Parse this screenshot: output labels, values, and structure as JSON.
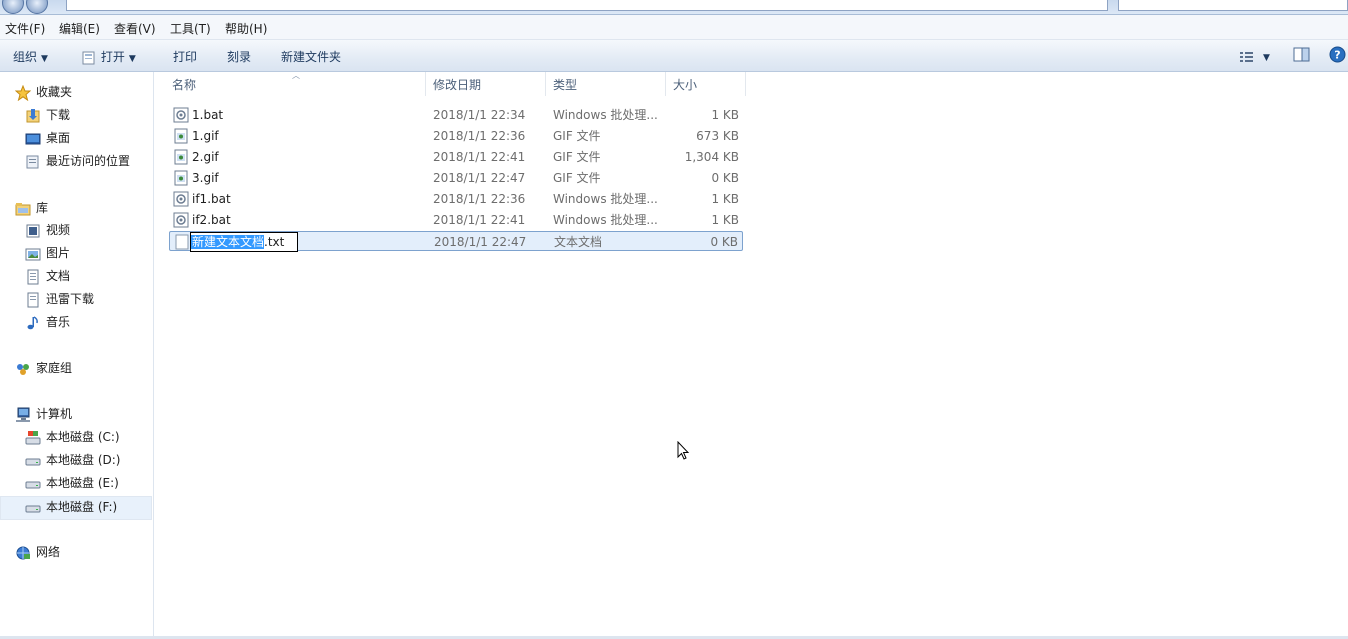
{
  "menubar": {
    "items": [
      "文件(F)",
      "编辑(E)",
      "查看(V)",
      "工具(T)",
      "帮助(H)"
    ]
  },
  "toolbar": {
    "organize": "组织",
    "open": "打开",
    "print": "打印",
    "burn": "刻录",
    "new_folder": "新建文件夹",
    "view_icon": "view-options-icon",
    "preview_icon": "preview-pane-icon",
    "help_icon": "help-icon"
  },
  "nav": {
    "favorites": {
      "label": "收藏夹",
      "items": [
        "下载",
        "桌面",
        "最近访问的位置"
      ]
    },
    "libraries": {
      "label": "库",
      "items": [
        "视频",
        "图片",
        "文档",
        "迅雷下载",
        "音乐"
      ]
    },
    "homegroup": "家庭组",
    "computer": {
      "label": "计算机",
      "items": [
        "本地磁盘 (C:)",
        "本地磁盘 (D:)",
        "本地磁盘 (E:)",
        "本地磁盘 (F:)"
      ]
    },
    "network": "网络"
  },
  "columns": {
    "name": "名称",
    "date": "修改日期",
    "type": "类型",
    "size": "大小"
  },
  "files": [
    {
      "name": "1.bat",
      "date": "2018/1/1 22:34",
      "type": "Windows 批处理...",
      "size": "1 KB",
      "icon": "batch-file-icon"
    },
    {
      "name": "1.gif",
      "date": "2018/1/1 22:36",
      "type": "GIF 文件",
      "size": "673 KB",
      "icon": "gif-file-icon"
    },
    {
      "name": "2.gif",
      "date": "2018/1/1 22:41",
      "type": "GIF 文件",
      "size": "1,304 KB",
      "icon": "gif-file-icon"
    },
    {
      "name": "3.gif",
      "date": "2018/1/1 22:47",
      "type": "GIF 文件",
      "size": "0 KB",
      "icon": "gif-file-icon"
    },
    {
      "name": "if1.bat",
      "date": "2018/1/1 22:36",
      "type": "Windows 批处理...",
      "size": "1 KB",
      "icon": "batch-file-icon"
    },
    {
      "name": "if2.bat",
      "date": "2018/1/1 22:41",
      "type": "Windows 批处理...",
      "size": "1 KB",
      "icon": "batch-file-icon"
    }
  ],
  "renaming": {
    "selected_part": "新建文本文档",
    "extension": ".txt",
    "date": "2018/1/1 22:47",
    "type": "文本文档",
    "size": "0 KB",
    "icon": "text-file-icon"
  }
}
